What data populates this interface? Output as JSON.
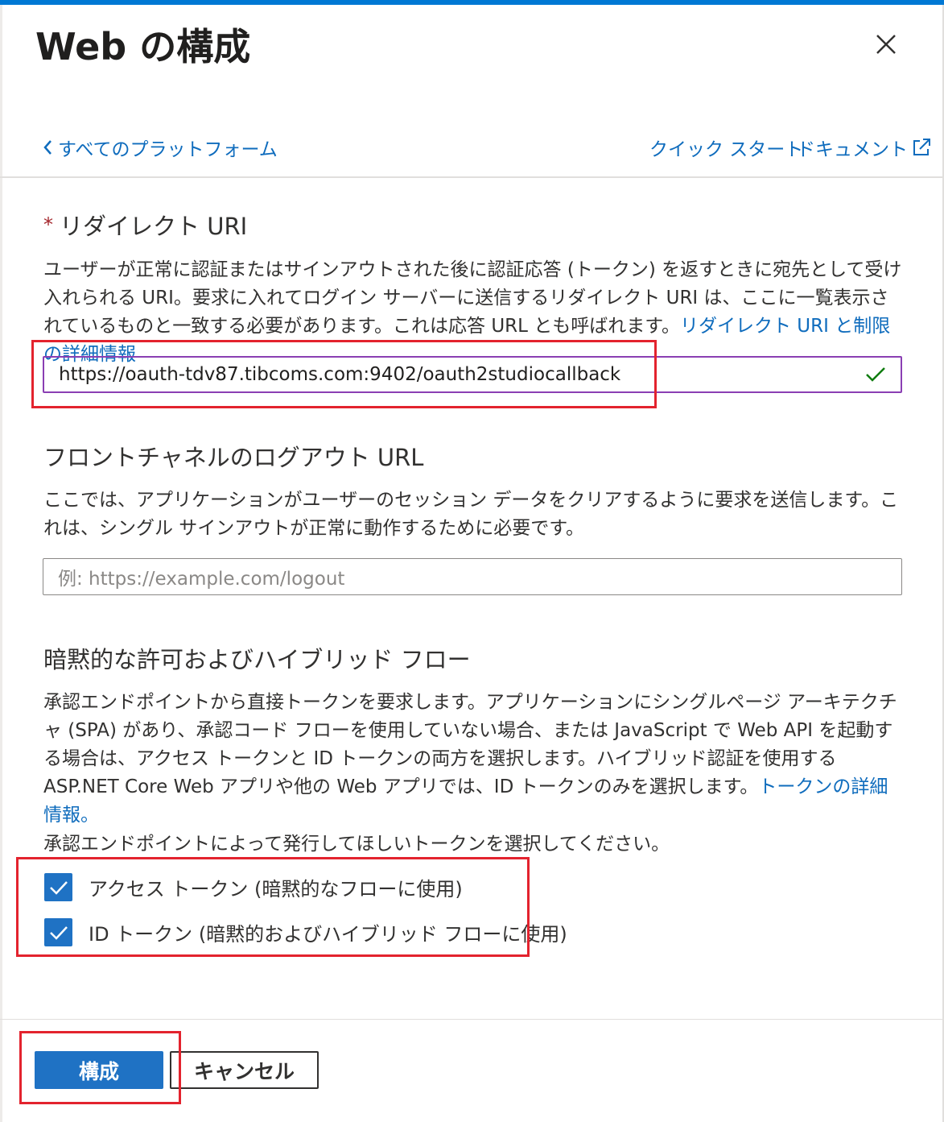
{
  "header": {
    "title": "Web の構成",
    "back_label": "すべてのプラットフォーム",
    "quickstart_label": "クイック スタート",
    "docs_label": "ドキュメント"
  },
  "redirect": {
    "required_mark": "*",
    "heading": "リダイレクト URI",
    "description": "ユーザーが正常に認証またはサインアウトされた後に認証応答 (トークン) を返すときに宛先として受け入れられる URI。要求に入れてログイン サーバーに送信するリダイレクト URI は、ここに一覧表示されているものと一致する必要があります。これは応答 URL とも呼ばれます。",
    "link": "リダイレクト URI と制限の詳細情報",
    "value": "https://oauth-tdv87.tibcoms.com:9402/oauth2studiocallback"
  },
  "logout": {
    "heading": "フロントチャネルのログアウト URL",
    "description": "ここでは、アプリケーションがユーザーのセッション データをクリアするように要求を送信します。これは、シングル サインアウトが正常に動作するために必要です。",
    "placeholder": "例: https://example.com/logout"
  },
  "implicit": {
    "heading": "暗黙的な許可およびハイブリッド フロー",
    "description": "承認エンドポイントから直接トークンを要求します。アプリケーションにシングルページ アーキテクチャ (SPA) があり、承認コード フローを使用していない場合、または JavaScript で Web API を起動する場合は、アクセス トークンと ID トークンの両方を選択します。ハイブリッド認証を使用する ASP.NET Core Web アプリや他の Web アプリでは、ID トークンのみを選択します。",
    "link": "トークンの詳細情報。",
    "instruction": "承認エンドポイントによって発行してほしいトークンを選択してください。",
    "access_token_label": "アクセス トークン (暗黙的なフローに使用)",
    "id_token_label": "ID トークン (暗黙的およびハイブリッド フローに使用)",
    "access_token_checked": true,
    "id_token_checked": true
  },
  "footer": {
    "configure_label": "構成",
    "cancel_label": "キャンセル"
  },
  "colors": {
    "accent": "#1f72c4",
    "link": "#0f6cbd",
    "highlight": "#e3232e",
    "valid": "#107c10"
  }
}
